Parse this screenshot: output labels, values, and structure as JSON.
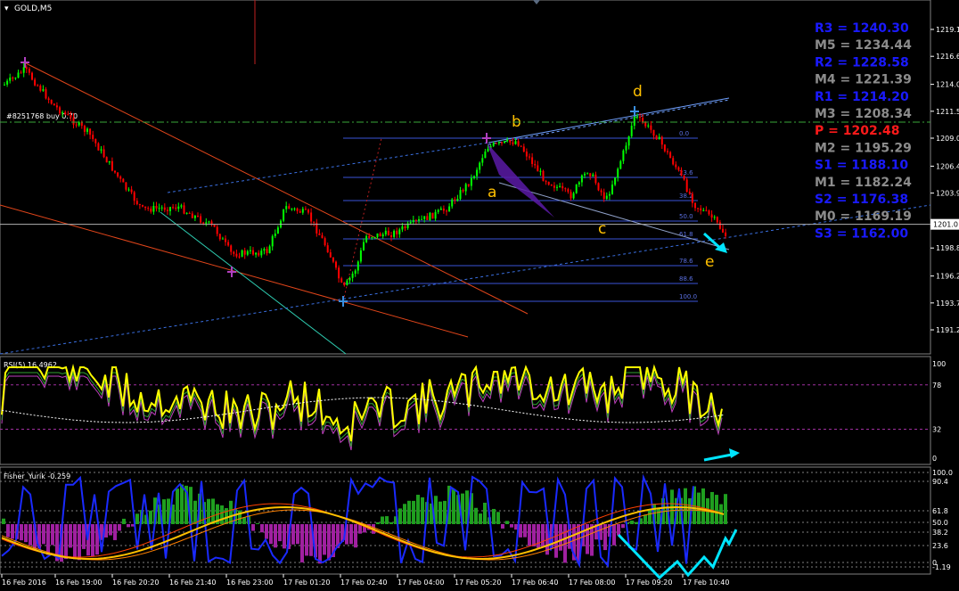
{
  "window": {
    "title": "GOLD,M5"
  },
  "order_label": "#8251768 buy 0.70",
  "price_axis": {
    "ticks": [
      "1219.1",
      "1216.6",
      "1214.0",
      "1211.5",
      "1209.0",
      "1206.4",
      "1203.9",
      "1198.8",
      "1196.2",
      "1193.7",
      "1191.2"
    ],
    "current_price": "1201.0"
  },
  "pivots": [
    {
      "label": "R3 = 1240.30",
      "color": "#1a1aff"
    },
    {
      "label": "M5 = 1234.44",
      "color": "#8c8c8c"
    },
    {
      "label": "R2 = 1228.58",
      "color": "#1a1aff"
    },
    {
      "label": "M4 = 1221.39",
      "color": "#8c8c8c"
    },
    {
      "label": "R1 = 1214.20",
      "color": "#1a1aff"
    },
    {
      "label": "M3 = 1208.34",
      "color": "#8c8c8c"
    },
    {
      "label": "P  = 1202.48",
      "color": "#ff1a1a"
    },
    {
      "label": "M2 = 1195.29",
      "color": "#8c8c8c"
    },
    {
      "label": "S1 = 1188.10",
      "color": "#1a1aff"
    },
    {
      "label": "M1 = 1182.24",
      "color": "#8c8c8c"
    },
    {
      "label": "S2 = 1176.38",
      "color": "#1a1aff"
    },
    {
      "label": "M0 = 1169.19",
      "color": "#8c8c8c"
    },
    {
      "label": "S3 = 1162.00",
      "color": "#1a1aff"
    }
  ],
  "fib_levels": [
    "0.0",
    "23.6",
    "38.2",
    "50.0",
    "61.8",
    "78.6",
    "88.6",
    "100.0"
  ],
  "wave_labels": [
    "a",
    "b",
    "c",
    "d",
    "e"
  ],
  "rsi": {
    "title": "RSI(5) 16.4962",
    "levels": [
      "100",
      "78",
      "32",
      "0"
    ]
  },
  "fisher": {
    "title": "Fisher_Yurik -0.259",
    "levels": [
      "100.0",
      "90.4",
      "61.8",
      "50.0",
      "38.2",
      "23.6",
      "0",
      "-1.19"
    ]
  },
  "time_axis": [
    "16 Feb 2016",
    "16 Feb 19:00",
    "16 Feb 20:20",
    "16 Feb 21:40",
    "16 Feb 23:00",
    "17 Feb 01:20",
    "17 Feb 02:40",
    "17 Feb 04:00",
    "17 Feb 05:20",
    "17 Feb 06:40",
    "17 Feb 08:00",
    "17 Feb 09:20",
    "17 Feb 10:40"
  ],
  "colors": {
    "bull": "#00ff00",
    "bear": "#ff0000",
    "rsi": "#ffff00",
    "fisher_pos": "#1f9f1f",
    "fisher_neg": "#a020a0",
    "arrow": "#00e5ff",
    "wave": "#ffc000"
  }
}
